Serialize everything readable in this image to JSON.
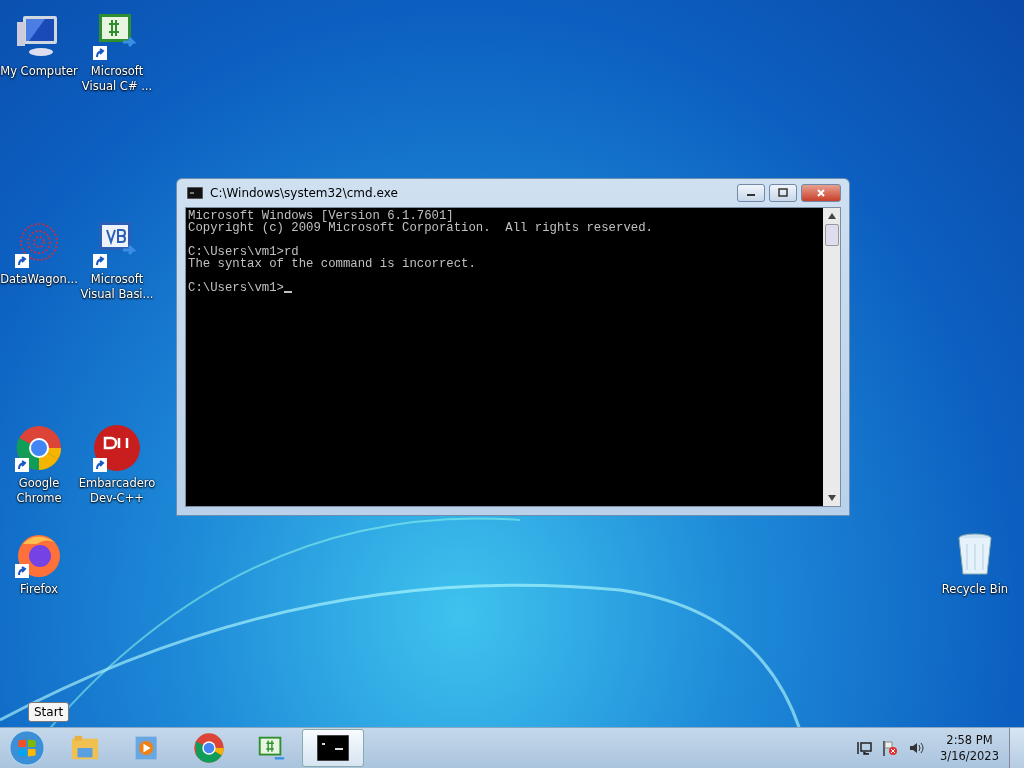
{
  "desktop_icons": [
    {
      "kind": "computer",
      "label": "My Computer",
      "shortcut": false
    },
    {
      "kind": "csharp",
      "label": "Microsoft Visual C# ...",
      "shortcut": true
    },
    {
      "kind": "datawagon",
      "label": "DataWagon...",
      "shortcut": true
    },
    {
      "kind": "vb",
      "label": "Microsoft Visual Basi...",
      "shortcut": true
    },
    {
      "kind": "chrome",
      "label": "Google Chrome",
      "shortcut": true
    },
    {
      "kind": "devcpp",
      "label": "Embarcadero Dev-C++",
      "shortcut": true
    },
    {
      "kind": "firefox",
      "label": "Firefox",
      "shortcut": true
    },
    {
      "kind": "recycle",
      "label": "Recycle Bin",
      "shortcut": false
    }
  ],
  "window": {
    "title": "C:\\Windows\\system32\\cmd.exe",
    "console_blocks": [
      [
        "Microsoft Windows [Version 6.1.7601]",
        "Copyright (c) 2009 Microsoft Corporation.  All rights reserved."
      ],
      [
        "C:\\Users\\vm1>rd",
        "The syntax of the command is incorrect."
      ],
      [
        "C:\\Users\\vm1>"
      ]
    ]
  },
  "tooltip": "Start",
  "taskbar": {
    "items": [
      {
        "kind": "start",
        "selected": false
      },
      {
        "kind": "explorer",
        "selected": false
      },
      {
        "kind": "media",
        "selected": false
      },
      {
        "kind": "chrome",
        "selected": false
      },
      {
        "kind": "csharp",
        "selected": false
      },
      {
        "kind": "cmd",
        "selected": true
      }
    ],
    "time": "2:58 PM",
    "date": "3/16/2023"
  }
}
